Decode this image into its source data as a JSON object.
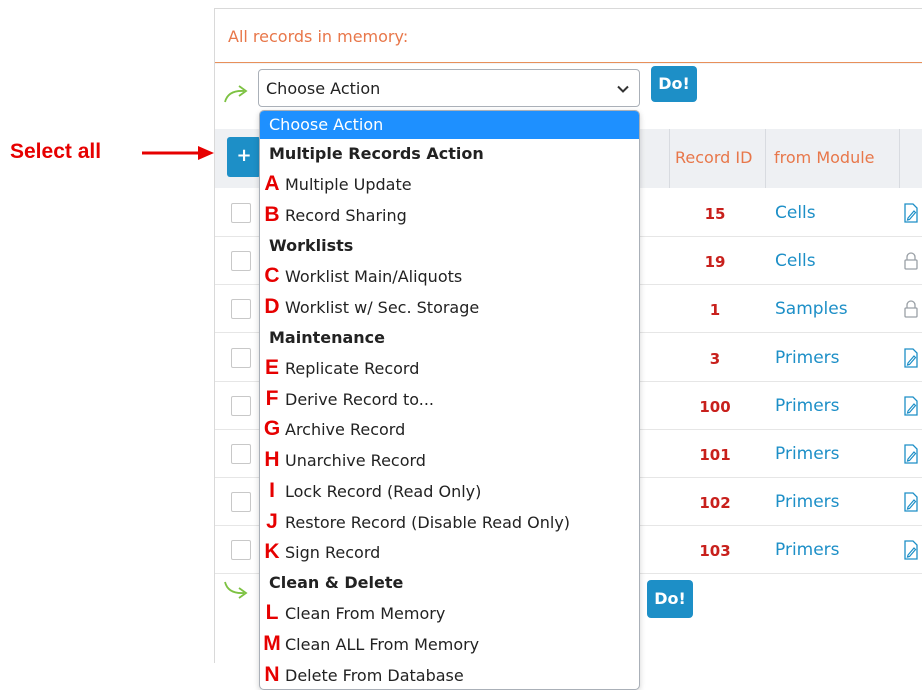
{
  "panel": {
    "title": "All records in memory:"
  },
  "action_bar": {
    "select_value": "Choose Action",
    "do_label": "Do!"
  },
  "table": {
    "add_label": "+",
    "columns": [
      "Record ID",
      "from Module"
    ],
    "rows": [
      {
        "id": "15",
        "module": "Cells",
        "icon": "edit-icon"
      },
      {
        "id": "19",
        "module": "Cells",
        "icon": "lock-icon"
      },
      {
        "id": "1",
        "module": "Samples",
        "icon": "lock-icon"
      },
      {
        "id": "3",
        "module": "Primers",
        "icon": "edit-icon"
      },
      {
        "id": "100",
        "module": "Primers",
        "icon": "edit-icon"
      },
      {
        "id": "101",
        "module": "Primers",
        "icon": "edit-icon"
      },
      {
        "id": "102",
        "module": "Primers",
        "icon": "edit-icon"
      },
      {
        "id": "103",
        "module": "Primers",
        "icon": "edit-icon"
      }
    ]
  },
  "bottom_bar": {
    "do_label": "Do!"
  },
  "annotation": {
    "select_all": "Select all"
  },
  "dropdown": {
    "options": [
      {
        "kind": "selected",
        "letter": "",
        "label": "Choose Action"
      },
      {
        "kind": "group",
        "letter": "",
        "label": "Multiple Records Action"
      },
      {
        "kind": "option",
        "letter": "A",
        "label": "Multiple Update"
      },
      {
        "kind": "option",
        "letter": "B",
        "label": "Record Sharing"
      },
      {
        "kind": "group",
        "letter": "",
        "label": "Worklists"
      },
      {
        "kind": "option",
        "letter": "C",
        "label": "Worklist Main/Aliquots"
      },
      {
        "kind": "option",
        "letter": "D",
        "label": "Worklist w/ Sec. Storage"
      },
      {
        "kind": "group",
        "letter": "",
        "label": "Maintenance"
      },
      {
        "kind": "option",
        "letter": "E",
        "label": "Replicate Record"
      },
      {
        "kind": "option",
        "letter": "F",
        "label": "Derive Record to..."
      },
      {
        "kind": "option",
        "letter": "G",
        "label": "Archive Record"
      },
      {
        "kind": "option",
        "letter": "H",
        "label": "Unarchive Record"
      },
      {
        "kind": "option",
        "letter": "I",
        "label": "Lock Record (Read Only)"
      },
      {
        "kind": "option",
        "letter": "J",
        "label": "Restore Record (Disable Read Only)"
      },
      {
        "kind": "option",
        "letter": "K",
        "label": "Sign Record"
      },
      {
        "kind": "group",
        "letter": "",
        "label": "Clean & Delete"
      },
      {
        "kind": "option",
        "letter": "L",
        "label": "Clean From Memory"
      },
      {
        "kind": "option",
        "letter": "M",
        "label": "Clean ALL From Memory"
      },
      {
        "kind": "option",
        "letter": "N",
        "label": "Delete From Database"
      }
    ]
  },
  "colors": {
    "accent_orange": "#e8774a",
    "button_blue": "#1d8fc7",
    "selected_blue": "#1e90ff",
    "annotation_red": "#e60000",
    "record_id_red": "#c8201c"
  }
}
